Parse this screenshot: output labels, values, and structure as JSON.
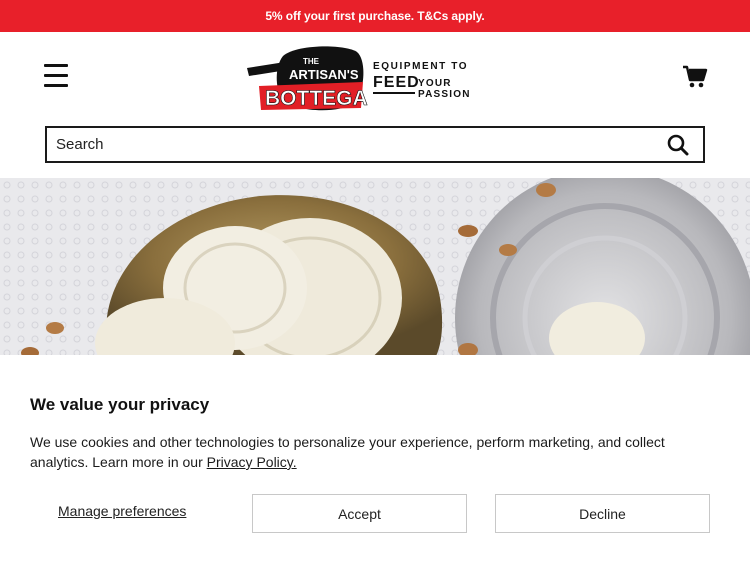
{
  "promo": {
    "text": "5% off your first purchase. T&Cs apply."
  },
  "header": {
    "logo": {
      "brand_line1": "THE",
      "brand_line2": "ARTISAN'S",
      "brand_line3": "BOTTEGA",
      "tagline_top": "EQUIPMENT TO",
      "tagline_feed": "FEED",
      "tagline_bottom": "YOUR PASSION"
    },
    "menu_icon": "hamburger-menu-icon",
    "cart_icon": "shopping-cart-icon"
  },
  "search": {
    "placeholder": "Search",
    "value": "",
    "icon": "search-icon"
  },
  "cookie": {
    "title": "We value your privacy",
    "body": "We use cookies and other technologies to personalize your experience, perform marketing, and collect analytics. Learn more in our",
    "link_label": "Privacy Policy.",
    "manage_label": "Manage preferences",
    "accept_label": "Accept",
    "decline_label": "Decline"
  },
  "colors": {
    "promo_bg": "#e8202a",
    "brand_red": "#e21f26",
    "text": "#111111",
    "button_border": "#c8c8c8"
  }
}
